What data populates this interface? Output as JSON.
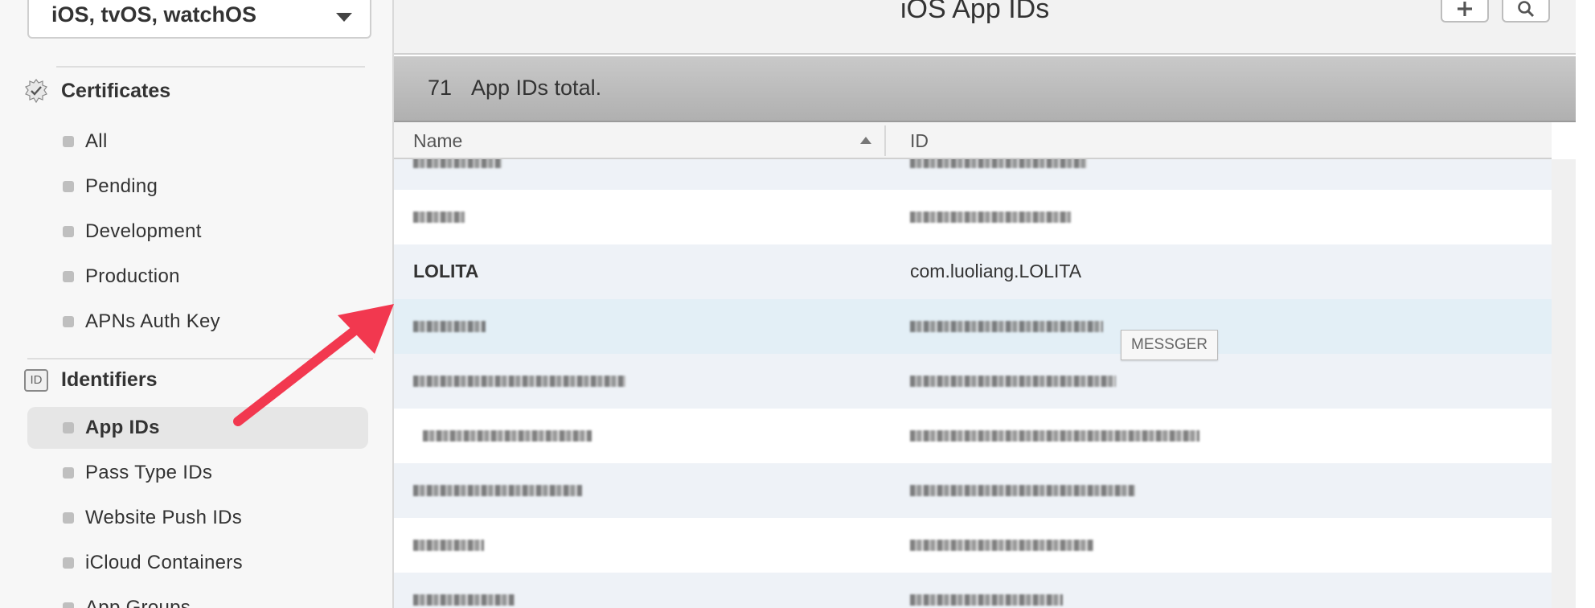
{
  "sidebar": {
    "platform": "iOS, tvOS, watchOS",
    "certificates": {
      "title": "Certificates",
      "items": [
        "All",
        "Pending",
        "Development",
        "Production",
        "APNs Auth Key"
      ]
    },
    "identifiers": {
      "title": "Identifiers",
      "icon_text": "ID",
      "items": [
        "App IDs",
        "Pass Type IDs",
        "Website Push IDs",
        "iCloud Containers",
        "App Groups"
      ],
      "active": "App IDs"
    }
  },
  "header": {
    "title": "iOS App IDs",
    "add_icon": "plus-icon",
    "search_icon": "search-icon"
  },
  "summary": {
    "count": "71",
    "label": "App IDs total."
  },
  "table": {
    "columns": [
      "Name",
      "ID"
    ],
    "sorted_by": "Name",
    "sort_direction": "ascending",
    "visible_row": {
      "name": "LOLITA",
      "id": "com.luoliang.LOLITA"
    }
  },
  "tooltip": "MESSGER",
  "colors": {
    "accent_arrow": "#f2384f",
    "row_alt": "#eef2f7",
    "row_hover": "#e3eff6"
  }
}
